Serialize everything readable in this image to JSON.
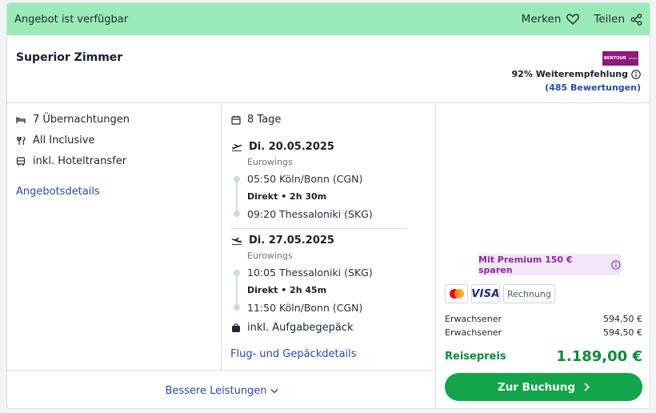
{
  "banner": {
    "title": "Angebot ist verfügbar",
    "save_label": "Merken",
    "share_label": "Teilen"
  },
  "header": {
    "room": "Superior Zimmer",
    "logo_text": "BENTOUR",
    "logo_sub": "reisen",
    "recommendation": "92% Weiterempfehlung",
    "reviews": "(485 Bewertungen)"
  },
  "features": {
    "nights": "7 Übernachtungen",
    "board": "All Inclusive",
    "transfer": "inkl. Hoteltransfer",
    "details_link": "Angebotsdetails"
  },
  "trip": {
    "days": "8 Tage",
    "outbound": {
      "date": "Di. 20.05.2025",
      "airline": "Eurowings",
      "depart": "05:50 Köln/Bonn (CGN)",
      "duration": "Direkt • 2h 30m",
      "arrive": "09:20 Thessaloniki (SKG)"
    },
    "return": {
      "date": "Di. 27.05.2025",
      "airline": "Eurowings",
      "depart": "10:05 Thessaloniki (SKG)",
      "duration": "Direkt • 2h 45m",
      "arrive": "11:50 Köln/Bonn (CGN)"
    },
    "baggage": "inkl. Aufgabegepäck",
    "details_link": "Flug- und Gepäckdetails"
  },
  "pricing": {
    "premium": "Mit Premium 150 € sparen",
    "payment_methods": [
      "Mastercard",
      "VISA",
      "Rechnung"
    ],
    "travellers": [
      {
        "label": "Erwachsener",
        "price": "594,50 €"
      },
      {
        "label": "Erwachsener",
        "price": "594,50 €"
      }
    ],
    "total_label": "Reisepreis",
    "total_value": "1.189,00 €",
    "book_label": "Zur Buchung"
  },
  "better_services": "Bessere Leistungen",
  "colors": {
    "banner": "#9bebb8",
    "accent_green": "#12a54a",
    "link_blue": "#2a4aa8",
    "premium_purple": "#8e2a9a"
  }
}
